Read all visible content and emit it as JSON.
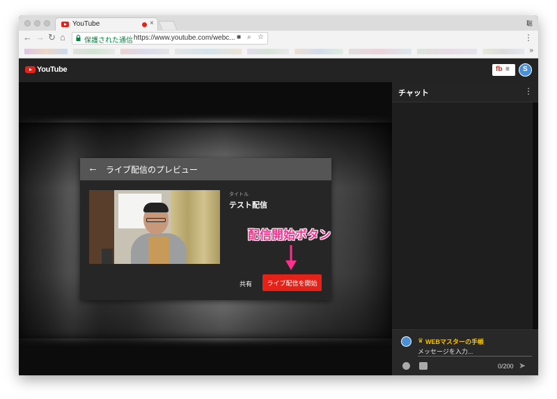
{
  "browser": {
    "tab_title": "YouTube",
    "tab_close": "×",
    "secure_label": "保護された通信",
    "url": "https://www.youtube.com/webc...",
    "profile_glyph": "聡",
    "nav_back": "←",
    "nav_forward": "→",
    "nav_reload": "↻",
    "nav_home": "⌂",
    "menu": "⋮",
    "bookmarks_more": "»",
    "video_icon": "■",
    "zoom_icon": "⌕",
    "star_icon": "☆"
  },
  "youtube": {
    "logo_text": "YouTube",
    "fb_label": "fb",
    "fb_menu": "≡",
    "avatar_glyph": "S"
  },
  "dialog": {
    "title": "ライブ配信のプレビュー",
    "back": "←",
    "field_label": "タイトル",
    "field_value": "テスト配信",
    "share_label": "共有",
    "start_label": "ライブ配信を開始"
  },
  "chat": {
    "title": "チャット",
    "menu": "⋮",
    "user_crown": "♛",
    "user_name": "WEBマスターの手帳",
    "placeholder": "メッセージを入力...",
    "counter": "0/200",
    "send": "➤"
  },
  "annotation": {
    "text": "配信開始ボタン"
  },
  "colors": {
    "accent": "#e62117",
    "annotation": "#ff2f8e",
    "chat_name": "#f7c300"
  }
}
